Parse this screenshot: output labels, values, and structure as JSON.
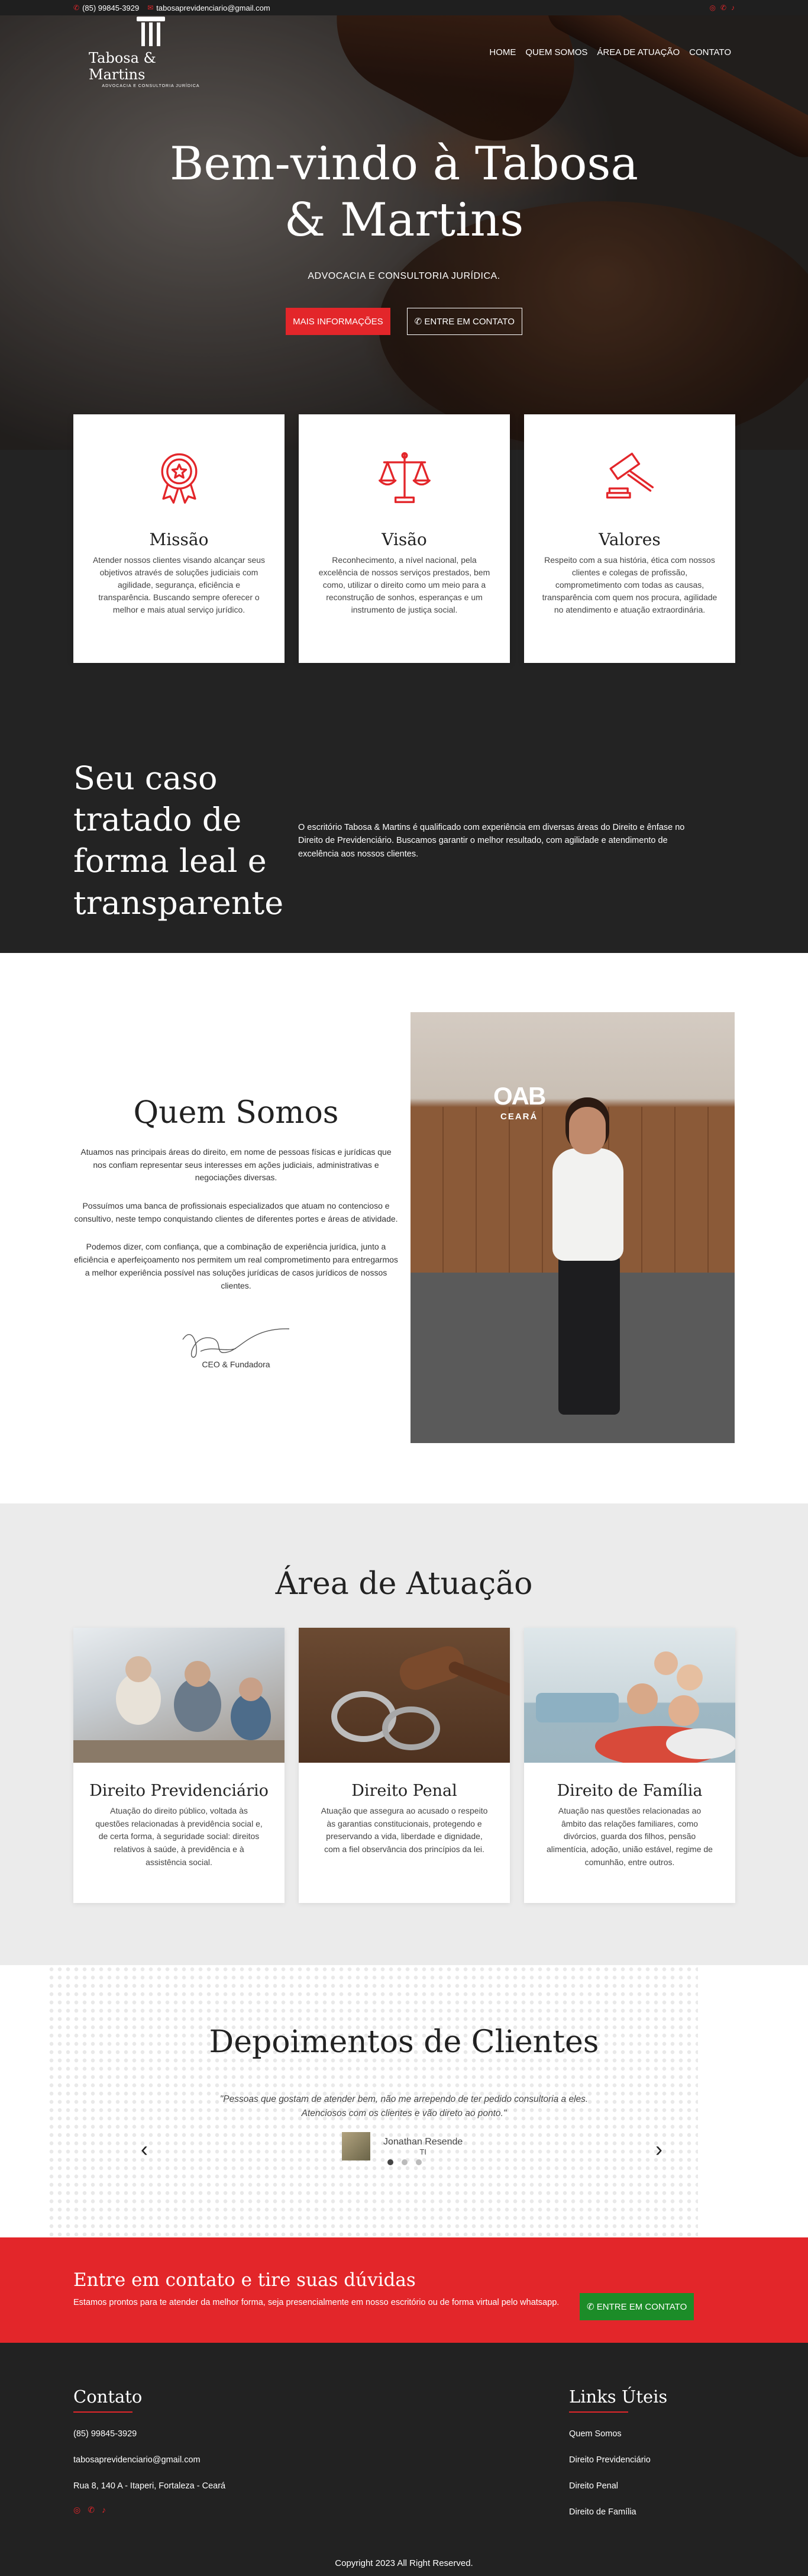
{
  "topbar": {
    "phone": "(85) 99845-3929",
    "email": "tabosaprevidenciario@gmail.com",
    "social": [
      "instagram-icon",
      "whatsapp-icon",
      "tiktok-icon"
    ]
  },
  "logo": {
    "name": "Tabosa & Martins",
    "tagline": "ADVOCACIA E CONSULTORIA JURÍDICA"
  },
  "nav": {
    "items": [
      "HOME",
      "QUEM SOMOS",
      "ÁREA DE ATUAÇÃO",
      "CONTATO"
    ]
  },
  "hero": {
    "title_line1": "Bem-vindo à Tabosa",
    "title_line2": "& Martins",
    "subtitle": "ADVOCACIA E CONSULTORIA JURÍDICA.",
    "btn_info": "MAIS INFORMAÇÕES",
    "btn_contact": "✆ ENTRE EM CONTATO"
  },
  "values": [
    {
      "title": "Missão",
      "icon": "award-icon",
      "text": "Atender nossos clientes visando alcançar seus objetivos através de soluções judiciais com agilidade, segurança, eficiência e transparência. Buscando sempre oferecer o melhor e mais atual serviço jurídico."
    },
    {
      "title": "Visão",
      "icon": "scales-icon",
      "text": "Reconhecimento, a nível nacional, pela excelência de nossos serviços prestados, bem como, utilizar o direito como um meio para a reconstrução de sonhos, esperanças e um instrumento de justiça social."
    },
    {
      "title": "Valores",
      "icon": "gavel-icon",
      "text": "Respeito com a sua história, ética com nossos clientes e colegas de profissão, comprometimento com todas as causas, transparência com quem nos procura, agilidade no atendimento e atuação extraordinária."
    }
  ],
  "tratado": {
    "title": "Seu caso tratado de forma leal e transparente",
    "text": "O escritório Tabosa & Martins é qualificado com experiência em diversas áreas do Direito e ênfase no Direito de Previdenciário. Buscamos garantir o melhor resultado, com agilidade e atendimento de excelência aos nossos clientes."
  },
  "quem": {
    "title": "Quem Somos",
    "p1": "Atuamos nas principais áreas do direito, em nome de pessoas físicas e jurídicas que nos confiam representar seus interesses em ações judiciais, administrativas e negociações diversas.",
    "p2": "Possuímos uma banca de profissionais especializados que atuam no contencioso e consultivo, neste tempo conquistando clientes de diferentes portes e áreas de atividade.",
    "p3": "Podemos dizer, com confiança, que a combinação de experiência jurídica, junto a eficiência e aperfeiçoamento nos permitem um real comprometimento para entregarmos a melhor experiência possível nas soluções jurídicas de casos jurídicos de nossos clientes.",
    "ceo": "CEO & Fundadora",
    "photo_oab": "OAB",
    "photo_ceara": "CEARÁ"
  },
  "area": {
    "title": "Área de Atuação",
    "cards": [
      {
        "title": "Direito Previdenciário",
        "text": "Atuação do direito público, voltada às questões relacionadas à previdência social e, de certa forma, à seguridade social: direitos relativos à saúde, à previdência e à assistência social."
      },
      {
        "title": "Direito Penal",
        "text": "Atuação que assegura ao acusado o respeito às garantias constitucionais, protegendo e preservando a vida, liberdade e dignidade, com a fiel observância dos princípios da lei."
      },
      {
        "title": "Direito de Família",
        "text": "Atuação nas questões relacionadas ao âmbito das relações familiares, como divórcios, guarda dos filhos, pensão alimentícia, adoção, união estável, regime de comunhão, entre outros."
      }
    ]
  },
  "depoimentos": {
    "title": "Depoimentos de Clientes",
    "quote_line1": "\"Pessoas que gostam de atender bem, não me arrependo de ter pedido consultoria a eles.",
    "quote_line2": "Atenciosos com os clientes e vão direto ao ponto.\"",
    "author": "Jonathan Resende",
    "role": "TI",
    "prev": "‹",
    "next": "›",
    "current_slide": 1,
    "total_slides": 3
  },
  "cta": {
    "title": "Entre em contato e tire suas dúvidas",
    "text": "Estamos prontos para te atender da melhor forma, seja presencialmente em nosso escritório ou de forma virtual pelo whatsapp.",
    "button": "✆ ENTRE EM CONTATO"
  },
  "footer": {
    "contact_title": "Contato",
    "phone": "(85) 99845-3929",
    "email": "tabosaprevidenciario@gmail.com",
    "address": "Rua 8, 140 A - Itaperi, Fortaleza - Ceará",
    "links_title": "Links Úteis",
    "links": [
      "Quem Somos",
      "Direito Previdenciário",
      "Direito Penal",
      "Direito de Família"
    ],
    "copyright": "Copyright 2023 All Right Reserved."
  },
  "colors": {
    "accent": "#e3262a",
    "dark": "#232323",
    "green": "#1c8c28"
  }
}
